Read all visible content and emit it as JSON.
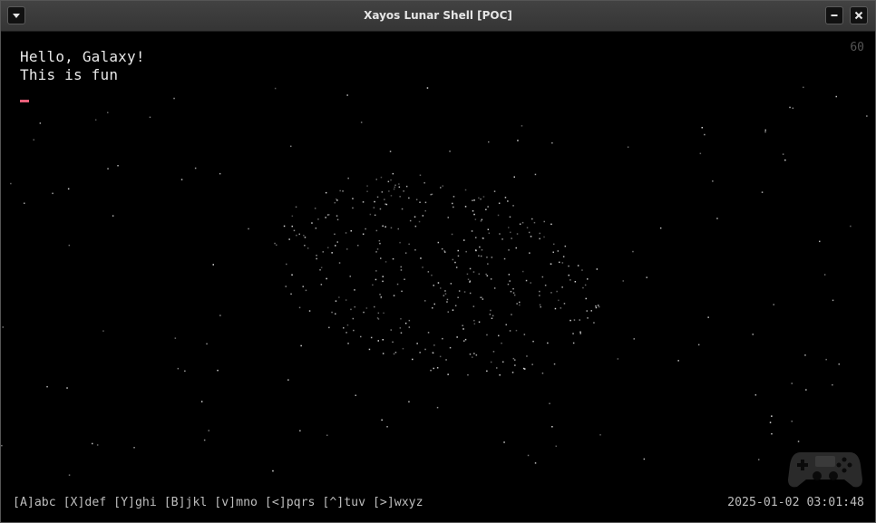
{
  "window": {
    "title": "Xayos Lunar Shell [POC]",
    "menu_icon": "chevron-down-icon",
    "minimize_icon": "minimize-icon",
    "close_icon": "close-icon"
  },
  "console": {
    "lines": [
      "Hello, Galaxy!",
      "This is fun"
    ],
    "cursor_color": "#e8607a",
    "fps_counter": "60"
  },
  "footer": {
    "key_hints": "[A]abc [X]def [Y]ghi [B]jkl [v]mno [<]pqrs [^]tuv [>]wxyz",
    "datetime": "2025-01-02 03:01:48",
    "controller_icon": "gamepad-icon"
  },
  "colors": {
    "background": "#000000",
    "titlebar": "#3c3c3c",
    "text": "#e8e8e8",
    "hint_text": "#bdbdbd",
    "fps_text": "#555555"
  }
}
